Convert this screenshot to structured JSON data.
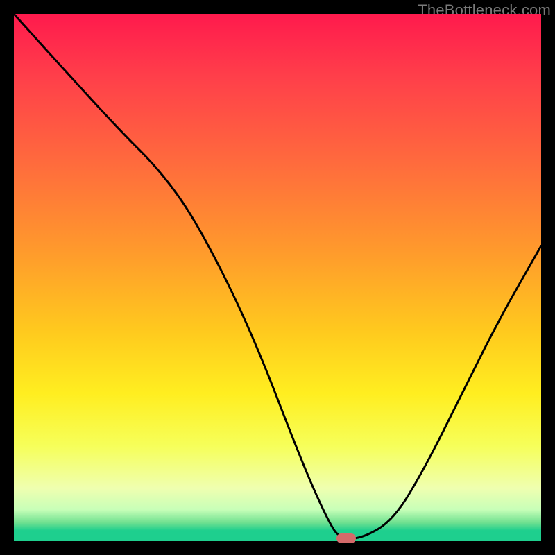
{
  "watermark": "TheBottleneck.com",
  "chart_data": {
    "type": "line",
    "title": "",
    "xlabel": "",
    "ylabel": "",
    "xlim": [
      0,
      100
    ],
    "ylim": [
      0,
      100
    ],
    "grid": false,
    "legend": false,
    "series": [
      {
        "name": "bottleneck-curve",
        "x": [
          0,
          9,
          20,
          28,
          35,
          45,
          55,
          60,
          62,
          66,
          72,
          78,
          85,
          92,
          100
        ],
        "y": [
          100,
          90,
          78,
          70,
          60,
          40,
          14,
          3,
          0.5,
          0.5,
          4,
          14,
          28,
          42,
          56
        ]
      }
    ],
    "marker": {
      "x": 63,
      "y": 0.5
    },
    "background_gradient_stops": [
      {
        "pos": 0,
        "color": "#ff1a4d"
      },
      {
        "pos": 0.45,
        "color": "#ff9a2c"
      },
      {
        "pos": 0.72,
        "color": "#ffee20"
      },
      {
        "pos": 0.94,
        "color": "#c8ffb8"
      },
      {
        "pos": 1.0,
        "color": "#1ecf8e"
      }
    ]
  }
}
